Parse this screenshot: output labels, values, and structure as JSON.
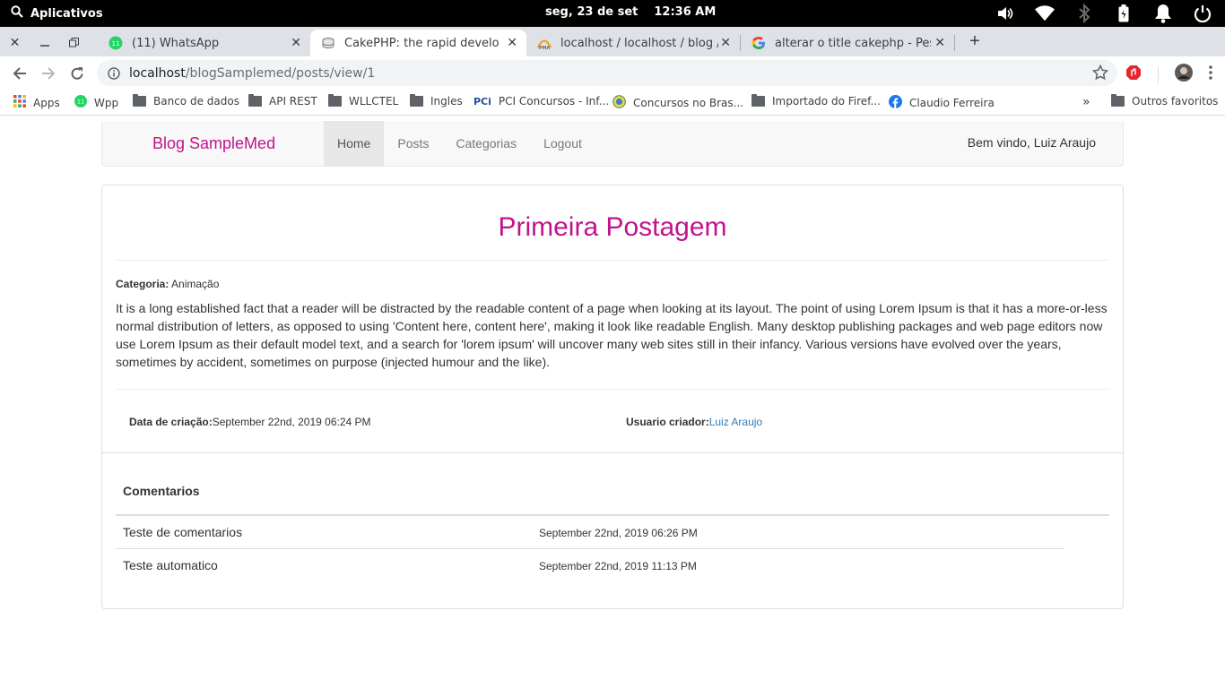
{
  "system_bar": {
    "apps_label": "Aplicativos",
    "date": "seg, 23 de set",
    "time": "12:36 AM"
  },
  "browser": {
    "tabs": [
      {
        "title": "(11) WhatsApp",
        "badge": "11"
      },
      {
        "title": "CakePHP: the rapid developme"
      },
      {
        "title": "localhost / localhost / blog / pos"
      },
      {
        "title": "alterar o title cakephp - Pesquis"
      }
    ],
    "url": {
      "host": "localhost",
      "path": "/blogSamplemed/posts/view/1"
    },
    "bookmarks": [
      {
        "label": "Apps",
        "icon": "apps-grid-icon"
      },
      {
        "label": "Wpp",
        "icon": "whatsapp-icon"
      },
      {
        "label": "Banco de dados",
        "icon": "folder-icon"
      },
      {
        "label": "API REST",
        "icon": "folder-icon"
      },
      {
        "label": "WLLCTEL",
        "icon": "folder-icon"
      },
      {
        "label": "Ingles",
        "icon": "folder-icon"
      },
      {
        "label": "PCI Concursos - Inf...",
        "icon": "pci-icon",
        "icon_text": "PCi"
      },
      {
        "label": "Concursos no Bras...",
        "icon": "globe-icon"
      },
      {
        "label": "Importado do Firef...",
        "icon": "folder-icon"
      },
      {
        "label": "Claudio Ferreira",
        "icon": "facebook-icon"
      }
    ],
    "more_bookmarks": "»",
    "other_bookmarks": "Outros favoritos"
  },
  "navbar": {
    "brand": "Blog SampleMed",
    "links": [
      "Home",
      "Posts",
      "Categorias",
      "Logout"
    ],
    "active": "Home",
    "welcome": "Bem vindo, Luiz Araujo"
  },
  "post": {
    "title": "Primeira Postagem",
    "category_label": "Categoria:",
    "category": "Animação",
    "body": "It is a long established fact that a reader will be distracted by the readable content of a page when looking at its layout. The point of using Lorem Ipsum is that it has a more-or-less normal distribution of letters, as opposed to using 'Content here, content here', making it look like readable English. Many desktop publishing packages and web page editors now use Lorem Ipsum as their default model text, and a search for 'lorem ipsum' will uncover many web sites still in their infancy. Various versions have evolved over the years, sometimes by accident, sometimes on purpose (injected humour and the like).",
    "created_label": "Data de criação:",
    "created": "September 22nd, 2019 06:24 PM",
    "author_label": "Usuario criador:",
    "author": "Luiz Araujo"
  },
  "comments": {
    "heading": "Comentarios",
    "items": [
      {
        "text": "Teste de comentarios",
        "date": "September 22nd, 2019 06:26 PM"
      },
      {
        "text": "Teste automatico",
        "date": "September 22nd, 2019 11:13 PM"
      }
    ]
  },
  "colors": {
    "brand": "#c0148c",
    "link": "#337ab7"
  }
}
